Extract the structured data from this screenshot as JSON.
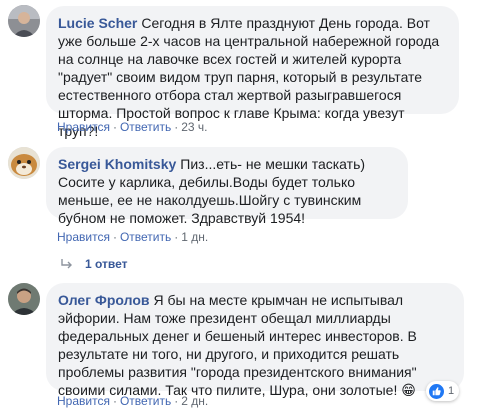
{
  "comments": [
    {
      "author": "Lucie Scher",
      "text": "Сегодня в Ялте празднуют День города. Вот уже больше 2-х часов на центральной набережной города на солнце на лавочке всех гостей и жителей курорта \"радует\" своим видом труп парня, который в результате естественного отбора стал жертвой разыгравшегося шторма. Простой вопрос к главе Крыма: когда увезут труп?!",
      "like": "Нравится",
      "reply": "Ответить",
      "time": "23 ч."
    },
    {
      "author": "Sergei Khomitsky",
      "text": "Пиз...еть- не мешки таскать) Сосите у карлика, дебилы.Воды будет только меньше, ее не наколдуешь.Шойгу с тувинским бубном не поможет. Здравствуй 1954!",
      "like": "Нравится",
      "reply": "Ответить",
      "time": "1 дн.",
      "replies_label": "1 ответ"
    },
    {
      "author": "Олег Фролов",
      "text": "Я бы на месте крымчан не испытывал эйфории. Нам тоже президент обещал миллиарды федеральных денег и бешеный интерес инвесторов. В результате ни того, ни другого, и приходится решать проблемы развития \"города президентского внимания\" своими силами. Так что пилите, Шура, они золотые! 😁",
      "like": "Нравится",
      "reply": "Ответить",
      "time": "2 дн.",
      "reaction_count": "1"
    }
  ],
  "colors": {
    "author": "#385898",
    "link": "#4267b2",
    "bubble": "#f2f3f5",
    "like_blue": "#2078f4"
  }
}
